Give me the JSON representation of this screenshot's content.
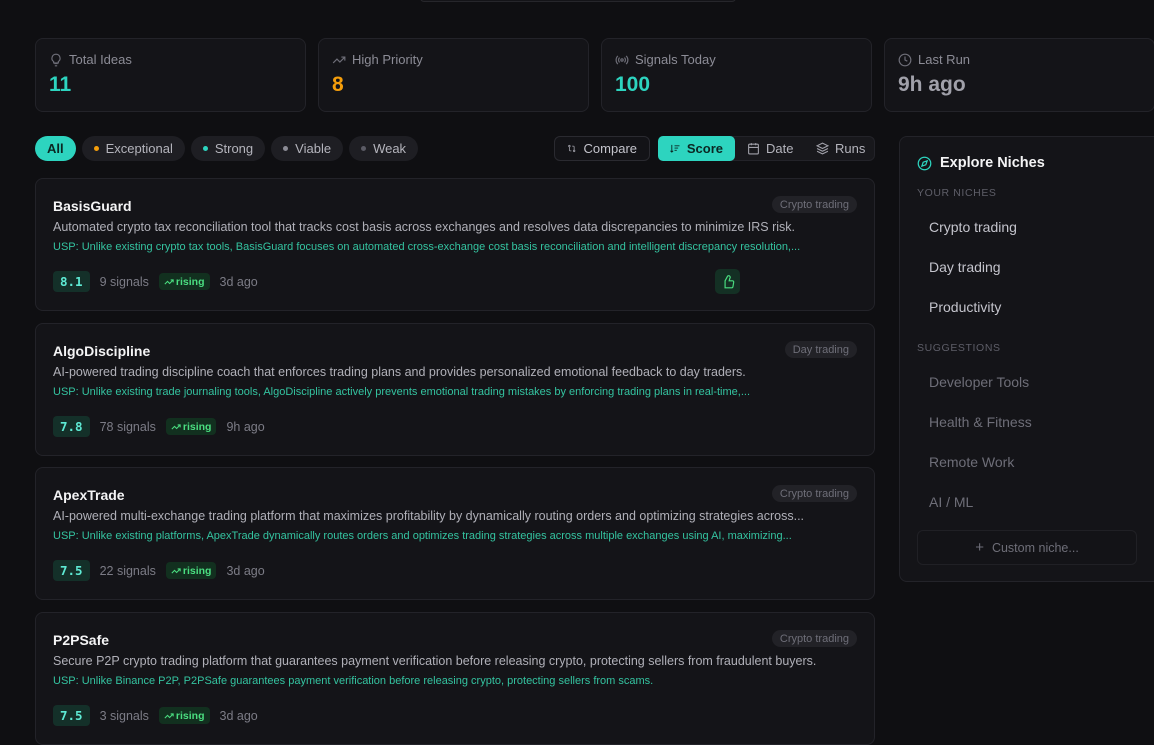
{
  "stats": [
    {
      "label": "Total Ideas",
      "value": "11",
      "color": "#2dd4bf",
      "icon": "lightbulb-icon"
    },
    {
      "label": "High Priority",
      "value": "8",
      "color": "#f59e0b",
      "icon": "trending-up-icon"
    },
    {
      "label": "Signals Today",
      "value": "100",
      "color": "#2dd4bf",
      "icon": "radio-signal-icon"
    },
    {
      "label": "Last Run",
      "value": "9h ago",
      "color": "#a1a1aa",
      "icon": "clock-icon"
    }
  ],
  "filters": [
    {
      "label": "All",
      "active": true
    },
    {
      "label": "Exceptional",
      "dot": "#f59e0b"
    },
    {
      "label": "Strong",
      "dot": "#2dd4bf"
    },
    {
      "label": "Viable",
      "dot": "#8b8b95"
    },
    {
      "label": "Weak",
      "dot": "#5b5b65"
    }
  ],
  "toolbar": {
    "compare": "Compare",
    "sort_score": "Score",
    "sort_date": "Date",
    "sort_runs": "Runs"
  },
  "ideas": [
    {
      "title": "BasisGuard",
      "tag": "Crypto trading",
      "desc": "Automated crypto tax reconciliation tool that tracks cost basis across exchanges and resolves data discrepancies to minimize IRS risk.",
      "usp": "USP: Unlike existing crypto tax tools, BasisGuard focuses on automated cross-exchange cost basis reconciliation and intelligent discrepancy resolution,...",
      "score": "8.1",
      "signals": "9 signals",
      "trend": "rising",
      "age": "3d ago",
      "liked": true
    },
    {
      "title": "AlgoDiscipline",
      "tag": "Day trading",
      "desc": "AI-powered trading discipline coach that enforces trading plans and provides personalized emotional feedback to day traders.",
      "usp": "USP: Unlike existing trade journaling tools, AlgoDiscipline actively prevents emotional trading mistakes by enforcing trading plans in real-time,...",
      "score": "7.8",
      "signals": "78 signals",
      "trend": "rising",
      "age": "9h ago"
    },
    {
      "title": "ApexTrade",
      "tag": "Crypto trading",
      "desc": "AI-powered multi-exchange trading platform that maximizes profitability by dynamically routing orders and optimizing strategies across...",
      "usp": "USP: Unlike existing platforms, ApexTrade dynamically routes orders and optimizes trading strategies across multiple exchanges using AI, maximizing...",
      "score": "7.5",
      "signals": "22 signals",
      "trend": "rising",
      "age": "3d ago"
    },
    {
      "title": "P2PSafe",
      "tag": "Crypto trading",
      "desc": "Secure P2P crypto trading platform that guarantees payment verification before releasing crypto, protecting sellers from fraudulent buyers.",
      "usp": "USP: Unlike Binance P2P, P2PSafe guarantees payment verification before releasing crypto, protecting sellers from scams.",
      "score": "7.5",
      "signals": "3 signals",
      "trend": "rising",
      "age": "3d ago"
    }
  ],
  "sidebar": {
    "title": "Explore Niches",
    "your_niches_label": "YOUR NICHES",
    "niches": [
      "Crypto trading",
      "Day trading",
      "Productivity"
    ],
    "suggestions_label": "SUGGESTIONS",
    "suggestions": [
      "Developer Tools",
      "Health & Fitness",
      "Remote Work",
      "AI / ML"
    ],
    "custom_label": "Custom niche..."
  }
}
